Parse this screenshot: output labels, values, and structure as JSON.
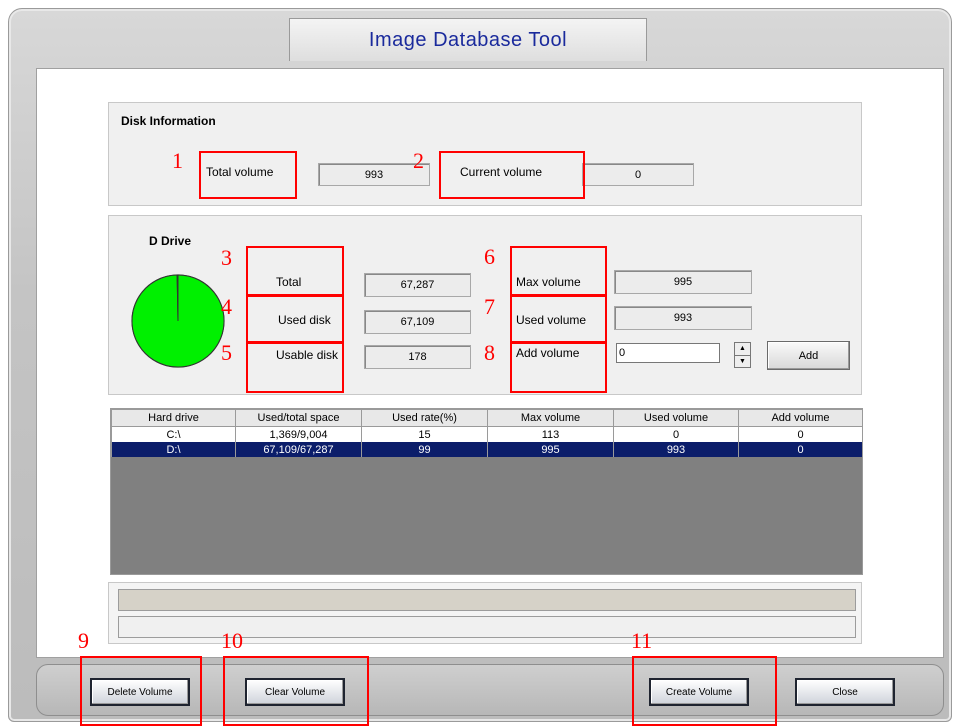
{
  "window": {
    "title": "Image Database Tool"
  },
  "disk_info": {
    "title": "Disk Information",
    "total_volume_label": "Total volume",
    "total_volume_value": "993",
    "current_volume_label": "Current volume",
    "current_volume_value": "0"
  },
  "drive": {
    "title": "D Drive",
    "total_label": "Total",
    "total_value": "67,287",
    "used_disk_label": "Used disk",
    "used_disk_value": "67,109",
    "usable_disk_label": "Usable disk",
    "usable_disk_value": "178",
    "max_volume_label": "Max volume",
    "max_volume_value": "995",
    "used_volume_label": "Used volume",
    "used_volume_value": "993",
    "add_volume_label": "Add volume",
    "add_volume_input": "0",
    "add_button": "Add",
    "pie": {
      "used_fraction": 0.997,
      "used_color": "#1a7a1a",
      "free_color": "#00f000"
    }
  },
  "table": {
    "columns": [
      "Hard drive",
      "Used/total space",
      "Used rate(%)",
      "Max volume",
      "Used volume",
      "Add volume"
    ],
    "rows": [
      [
        "C:\\",
        "1,369/9,004",
        "15",
        "113",
        "0",
        "0"
      ],
      [
        "D:\\",
        "67,109/67,287",
        "99",
        "995",
        "993",
        "0"
      ]
    ],
    "selected_row": 1
  },
  "buttons": {
    "delete": "Delete Volume",
    "clear": "Clear Volume",
    "create": "Create Volume",
    "close": "Close"
  },
  "annotations": [
    "1",
    "2",
    "3",
    "4",
    "5",
    "6",
    "7",
    "8",
    "9",
    "10",
    "11"
  ],
  "colors": {
    "title_text": "#1a2a9c",
    "annotation": "#ff0000",
    "selected_row": "#0b1d6a",
    "table_empty": "#808080"
  }
}
